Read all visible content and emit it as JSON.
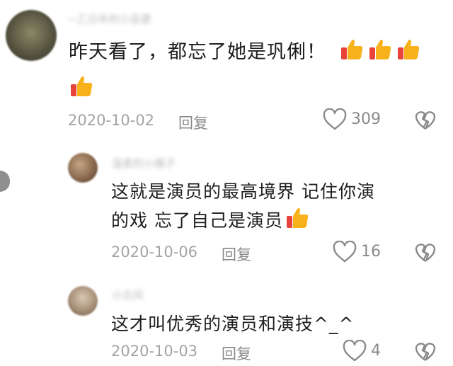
{
  "comments": [
    {
      "username": "~乙日年的小巫婆",
      "text": "昨天看了，都忘了她是巩俐！",
      "emoji": "thumbs-up-icon",
      "emoji_count": 4,
      "date": "2020-10-02",
      "reply_label": "回复",
      "likes": "309"
    },
    {
      "username": "温柔的小橘子",
      "text_line1": "这就是演员的最高境界 记住你演",
      "text_line2": "的戏 忘了自己是演员",
      "emoji": "thumbs-up-icon",
      "emoji_count": 1,
      "date": "2020-10-06",
      "reply_label": "回复",
      "likes": "16"
    },
    {
      "username": "小北风",
      "text": "这才叫优秀的演员和演技^_^",
      "date": "2020-10-03",
      "reply_label": "回复",
      "likes": "4"
    }
  ],
  "colors": {
    "thumb_yellow": "#f7b21b",
    "thumb_red": "#e8433a",
    "meta_gray": "#a3a3a3",
    "icon_gray": "#8a8a8a"
  }
}
